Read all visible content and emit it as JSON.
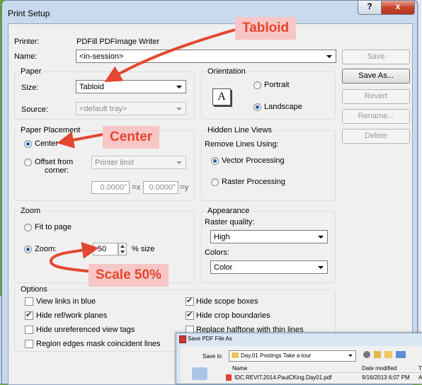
{
  "dialog": {
    "title": "Print Setup",
    "help_label": "?",
    "close_label": "x",
    "printer_label": "Printer:",
    "printer_value": "PDFill PDFImage Writer",
    "name_label": "Name:",
    "name_value": "<in-session>",
    "buttons": {
      "save": "Save",
      "save_as": "Save As...",
      "revert": "Revert",
      "rename": "Rename...",
      "delete": "Delete"
    }
  },
  "paper": {
    "title": "Paper",
    "size_label": "Size:",
    "size_value": "Tabloid",
    "source_label": "Source:",
    "source_value": "<default tray>"
  },
  "orientation": {
    "title": "Orientation",
    "icon_letter": "A",
    "portrait": "Portrait",
    "landscape": "Landscape"
  },
  "placement": {
    "title": "Paper Placement",
    "center": "Center",
    "offset": "Offset from corner:",
    "offset_line1": "Offset from",
    "offset_line2": "corner:",
    "offset_value": "Printer limit",
    "x_value": "0.0000\"",
    "x_label": "=x",
    "y_value": "0.0000\"",
    "y_label": "=y"
  },
  "hidden_line": {
    "title": "Hidden Line Views",
    "remove_label": "Remove Lines Using:",
    "vector": "Vector Processing",
    "raster": "Raster Processing"
  },
  "zoom": {
    "title": "Zoom",
    "fit": "Fit to page",
    "zoom_label": "Zoom:",
    "zoom_value": "50",
    "unit": "% size"
  },
  "appearance": {
    "title": "Appearance",
    "raster_label": "Raster quality:",
    "raster_value": "High",
    "colors_label": "Colors:",
    "colors_value": "Color"
  },
  "options": {
    "title": "Options",
    "items": [
      {
        "label": "View links in blue",
        "checked": false
      },
      {
        "label": "Hide ref/work planes",
        "checked": true
      },
      {
        "label": "Hide unreferenced view tags",
        "checked": false
      },
      {
        "label": "Region edges mask coincident lines",
        "checked": false
      },
      {
        "label": "Hide scope boxes",
        "checked": true
      },
      {
        "label": "Hide crop boundaries",
        "checked": true
      },
      {
        "label": "Replace halftone with thin lines",
        "checked": false
      }
    ]
  },
  "annotations": {
    "tabloid": "Tabloid",
    "center": "Center",
    "scale": "Scale 50%",
    "color": "#e4472f"
  },
  "save_pdf": {
    "title": "Save PDF File As",
    "save_in_label": "Save in:",
    "folder": "Day.01 Postings Take a tour",
    "col_name": "Name",
    "col_modified": "Date modified",
    "col_type": "T",
    "row_name": "IDC.REVIT.2014.PaulCKing.Day01.pdf",
    "row_modified": "9/16/2013 6:07 PM",
    "row_type": "A"
  }
}
